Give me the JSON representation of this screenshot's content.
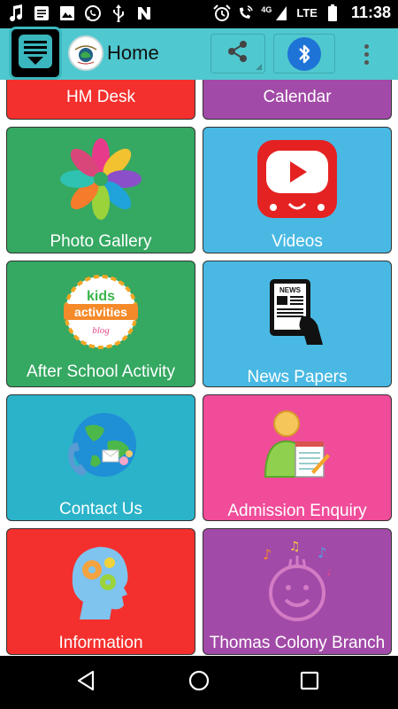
{
  "status_bar": {
    "time": "11:38",
    "network": "LTE",
    "network_small": "4G",
    "left_icons": [
      "music-note-icon",
      "notes-icon",
      "image-icon",
      "whatsapp-icon",
      "usb-icon",
      "n-icon"
    ],
    "right_icons": [
      "alarm-icon",
      "wifi-call-icon",
      "signal-icon",
      "battery-icon"
    ]
  },
  "app_bar": {
    "title": "Home",
    "background": "#50c8cf",
    "share_icon": "share-icon",
    "bluetooth_icon": "bluetooth-icon",
    "overflow_icon": "overflow-menu-icon"
  },
  "tiles": [
    {
      "label": "HM Desk",
      "color": "#f3302d"
    },
    {
      "label": "Calendar",
      "color": "#a24aa8"
    },
    {
      "label": "Photo Gallery",
      "color": "#35a862",
      "icon": "hands-icon"
    },
    {
      "label": "Videos",
      "color": "#49b9e3",
      "icon": "youtube-icon"
    },
    {
      "label": "After School Activity",
      "color": "#35a862",
      "icon": "kids-activities-icon",
      "icon_text": [
        "kids",
        "activities",
        "blog"
      ]
    },
    {
      "label": "News Papers",
      "color": "#49b9e3",
      "icon": "newspaper-tablet-icon",
      "icon_text": "NEWS"
    },
    {
      "label": "Contact Us",
      "color": "#2ab3c9",
      "icon": "globe-contact-icon"
    },
    {
      "label": "Admission Enquiry",
      "color": "#f04c9a",
      "icon": "user-notepad-icon"
    },
    {
      "label": "Information",
      "color": "#f3302d",
      "icon": "brain-gears-icon"
    },
    {
      "label": "Thomas Colony Branch",
      "color": "#a24aa8",
      "icon": "smiley-music-icon"
    }
  ],
  "nav_bar": {
    "back_icon": "back-icon",
    "home_icon": "home-icon",
    "recents_icon": "recents-icon"
  }
}
